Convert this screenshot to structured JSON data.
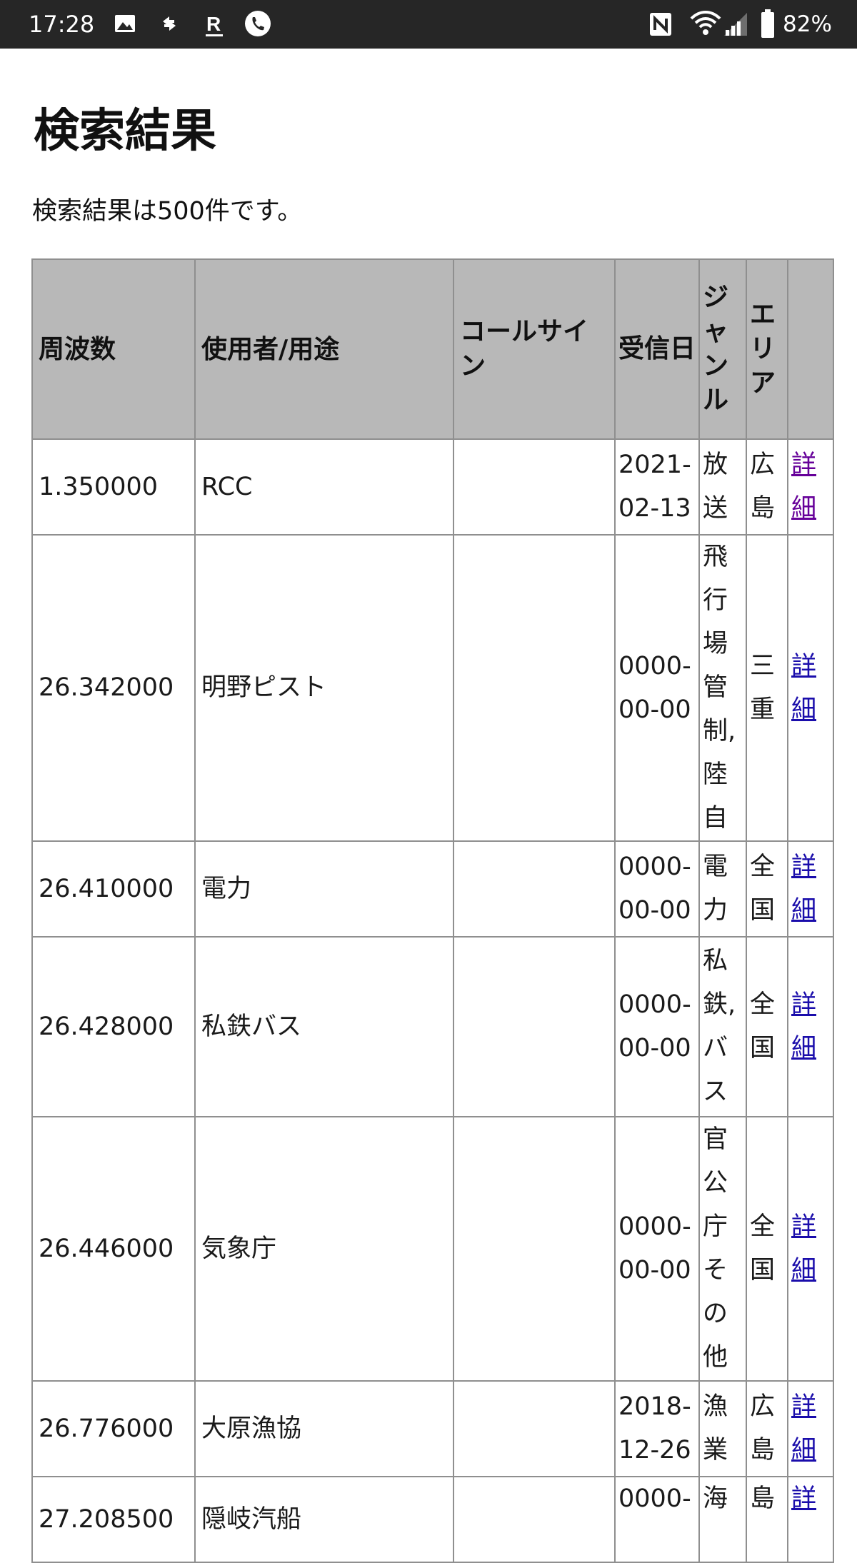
{
  "status_bar": {
    "time": "17:28",
    "battery": "82%",
    "icons": [
      "gallery-icon",
      "sync-icon",
      "rakuten-icon",
      "phone-icon",
      "nfc-icon",
      "wifi-icon",
      "signal-icon",
      "battery-icon"
    ],
    "rakuten_glyph": "R"
  },
  "page": {
    "title": "検索結果",
    "summary": "検索結果は500件です。"
  },
  "table": {
    "headers": {
      "frequency": "周波数",
      "user": "使用者/用途",
      "callsign": "コールサイン",
      "date": "受信日",
      "genre": "ジャンル",
      "area": "エリア",
      "link": ""
    },
    "rows": [
      {
        "frequency": "1.350000",
        "user": "RCC",
        "callsign": "",
        "date": "2021-02-13",
        "genre": "放送",
        "area": "広島",
        "link": "詳細"
      },
      {
        "frequency": "26.342000",
        "user": "明野ピスト",
        "callsign": "",
        "date": "0000-00-00",
        "genre": "飛行場管制,陸自",
        "area": "三重",
        "link": "詳細"
      },
      {
        "frequency": "26.410000",
        "user": "電力",
        "callsign": "",
        "date": "0000-00-00",
        "genre": "電力",
        "area": "全国",
        "link": "詳細"
      },
      {
        "frequency": "26.428000",
        "user": "私鉄バス",
        "callsign": "",
        "date": "0000-00-00",
        "genre": "私鉄,バス",
        "area": "全国",
        "link": "詳細"
      },
      {
        "frequency": "26.446000",
        "user": "気象庁",
        "callsign": "",
        "date": "0000-00-00",
        "genre": "官公庁その他",
        "area": "全国",
        "link": "詳細"
      },
      {
        "frequency": "26.776000",
        "user": "大原漁協",
        "callsign": "",
        "date": "2018-12-26",
        "genre": "漁業",
        "area": "広島",
        "link": "詳細"
      },
      {
        "frequency": "27.208500",
        "user": "隠岐汽船",
        "callsign": "",
        "date": "0000-",
        "genre": "海",
        "area": "島",
        "link": "詳"
      }
    ]
  },
  "colors": {
    "status_bar_bg": "#262626",
    "header_bg": "#b8b8b8",
    "border": "#8f8f8f",
    "link": "#1a0dab",
    "visited_link": "#660099"
  }
}
